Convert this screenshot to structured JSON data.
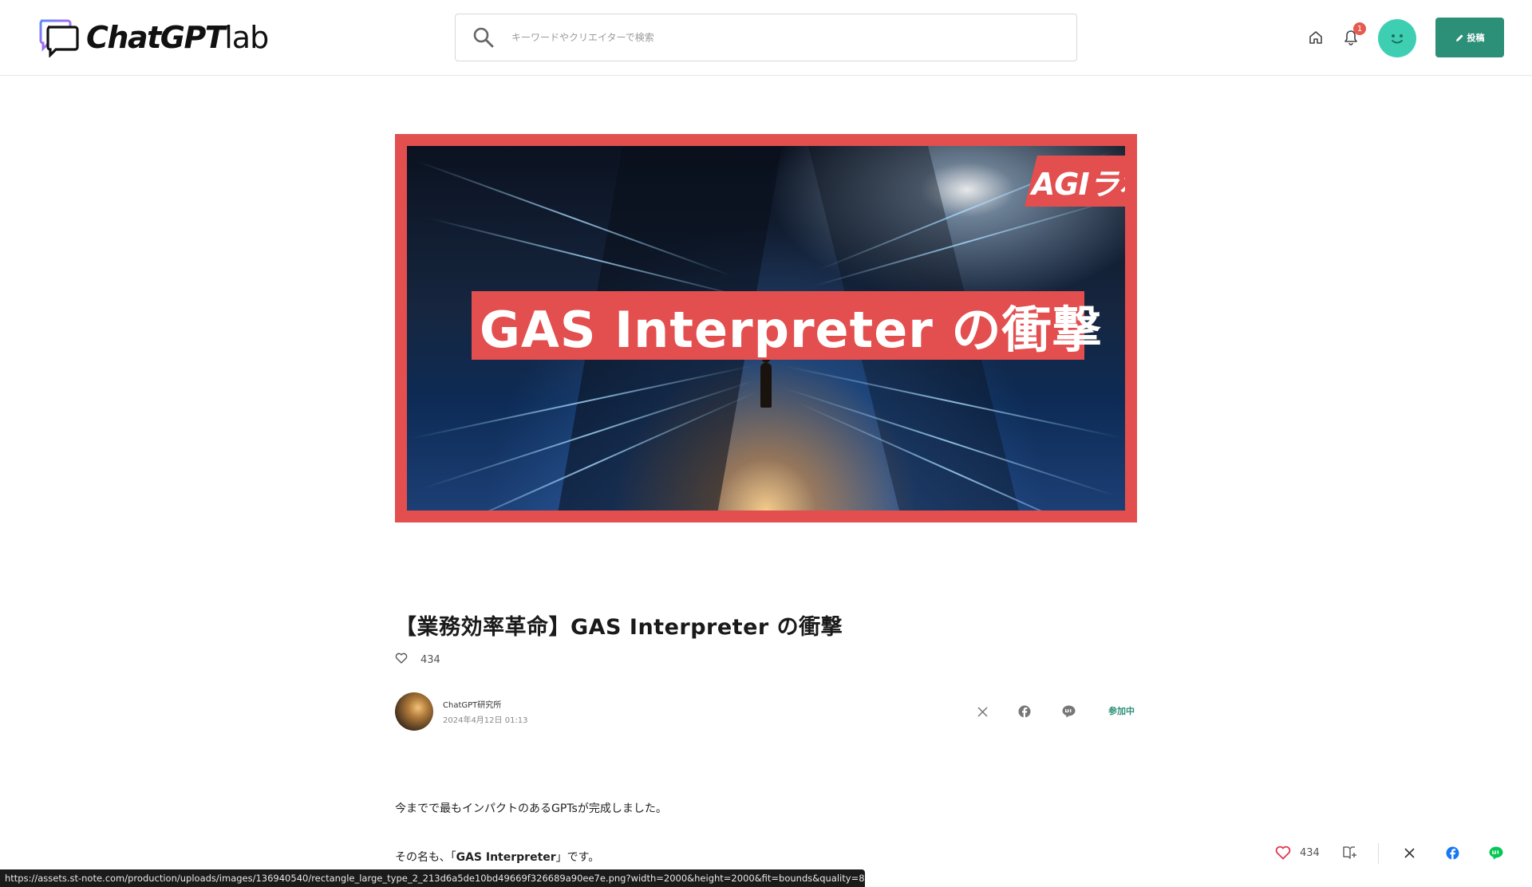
{
  "header": {
    "logo_main": "ChatGPT",
    "logo_sub": "lab",
    "search_placeholder": "キーワードやクリエイターで検索",
    "notification_count": "1",
    "post_label": "投稿"
  },
  "hero": {
    "band_text": "GAS Interpreter の衝撃",
    "brand_tag": "AGIラボ"
  },
  "article": {
    "title": "【業務効率革命】GAS Interpreter の衝撃",
    "like_count": "434",
    "author_name": "ChatGPT研究所",
    "published": "2024年4月12日 01:13",
    "join_label": "参加中",
    "paragraphs": [
      {
        "text": "今までで最もインパクトのあるGPTsが完成しました。"
      },
      {
        "before": "その名も、「",
        "bold": "GAS Interpreter",
        "after": "」です。"
      }
    ]
  },
  "floating_bar": {
    "like_count": "434"
  },
  "colors": {
    "brand_green": "#2c8f77",
    "avatar_teal": "#3ecfb3",
    "badge_red": "#e65a4f",
    "hero_red": "#e34e4f",
    "heart_red": "#e0384d",
    "facebook_blue": "#1877f2",
    "line_green": "#06c755"
  },
  "status_url": "https://assets.st-note.com/production/uploads/images/136940540/rectangle_large_type_2_213d6a5de10bd49669f326689a90ee7e.png?width=2000&height=2000&fit=bounds&quality=85"
}
